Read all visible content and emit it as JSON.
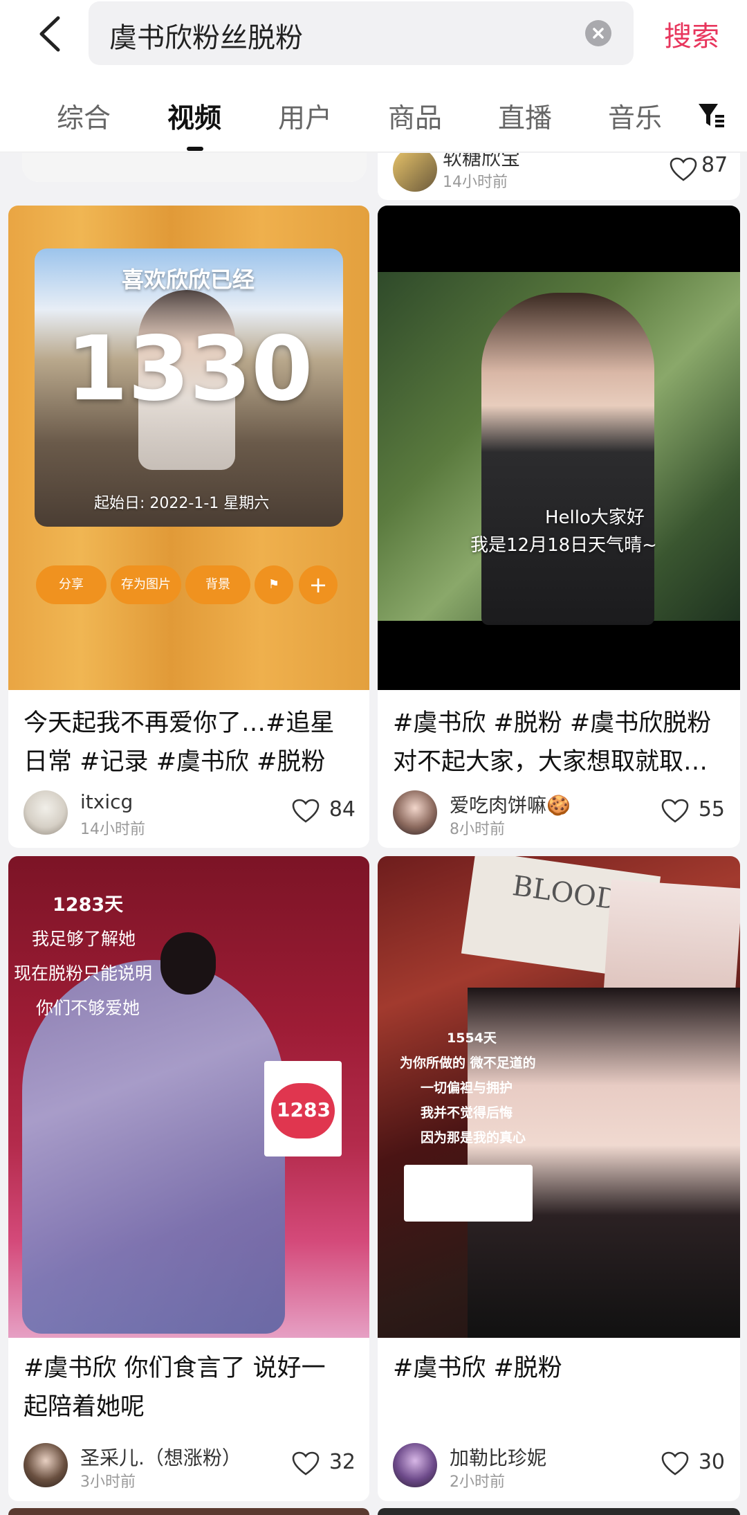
{
  "search": {
    "query": "虞书欣粉丝脱粉",
    "submit_label": "搜索"
  },
  "tabs": [
    {
      "label": "综合"
    },
    {
      "label": "视频"
    },
    {
      "label": "用户"
    },
    {
      "label": "商品"
    },
    {
      "label": "直播"
    },
    {
      "label": "音乐"
    }
  ],
  "active_tab": "视频",
  "prev_row": {
    "author": "软糖欣宝",
    "time": "14小时前",
    "likes": "87"
  },
  "cards": [
    {
      "title_lines": [
        "今天起我不再爱你了…#追星",
        "日常 #记录 #虞书欣 #脱粉"
      ],
      "author": "itxicg",
      "time": "14小时前",
      "likes": "84",
      "overlay": {
        "header": "喜欢欣欣已经",
        "count": "1330",
        "start": "起始日: 2022-1-1 星期六",
        "buttons": [
          "分享",
          "存为图片",
          "背景"
        ]
      }
    },
    {
      "title_lines": [
        "#虞书欣 #脱粉 #虞书欣脱粉",
        "对不起大家，大家想取就取…"
      ],
      "author": "爱吃肉饼嘛🍪",
      "time": "8小时前",
      "likes": "55",
      "overlay": {
        "line1": "Hello大家好",
        "line2": "我是12月18日天气晴~"
      }
    },
    {
      "title_lines": [
        "#虞书欣 你们食言了 说好一",
        "起陪着她呢"
      ],
      "author": "圣采儿.（想涨粉）",
      "time": "3小时前",
      "likes": "32",
      "overlay": {
        "lines": [
          "1283天",
          "我足够了解她",
          "现在脱粉只能说明",
          "你们不够爱她"
        ],
        "badge": "1283"
      }
    },
    {
      "title_lines": [
        "#虞书欣 #脱粉"
      ],
      "author": "加勒比珍妮",
      "time": "2小时前",
      "likes": "30",
      "overlay": {
        "blood": "BLOOD",
        "lines": [
          "1554天",
          "为你所做的 微不足道的",
          "一切偏袒与拥护",
          "我并不觉得后悔",
          "因为那是我的真心"
        ]
      }
    }
  ],
  "colors": {
    "accent": "#e8365d",
    "card_bg": "#ffffff",
    "page_bg": "#f2f2f4"
  },
  "icons": [
    "back-arrow-icon",
    "clear-icon",
    "filter-icon",
    "heart-icon"
  ]
}
